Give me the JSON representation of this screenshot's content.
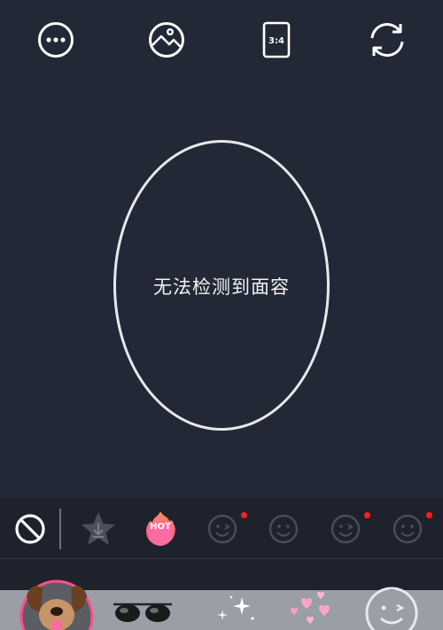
{
  "top_bar": {
    "buttons": [
      {
        "name": "more-options",
        "icon": "ellipsis-circle-icon"
      },
      {
        "name": "gallery",
        "icon": "photo-icon"
      },
      {
        "name": "aspect-ratio",
        "icon": "aspect-ratio-icon",
        "label": "3:4"
      },
      {
        "name": "switch-camera",
        "icon": "rotate-camera-icon"
      }
    ]
  },
  "face_guide": {
    "message": "无法检测到面容"
  },
  "effect_tabs": [
    {
      "name": "none",
      "icon": "no-effect-icon"
    },
    {
      "name": "favorites",
      "icon": "star-download-icon"
    },
    {
      "name": "hot",
      "icon": "hot-flame-icon",
      "label": "HOT",
      "color": "#ff5f9a"
    },
    {
      "name": "category-1",
      "icon": "wink-face-icon",
      "new": true
    },
    {
      "name": "category-2",
      "icon": "smile-face-icon",
      "new": false
    },
    {
      "name": "category-3",
      "icon": "wink-face-icon",
      "new": true
    },
    {
      "name": "category-4",
      "icon": "smile-face-icon",
      "new": true
    }
  ],
  "stickers": [
    {
      "name": "puppy-ears",
      "icon": "dog-face-icon",
      "selected": true,
      "ring_color": "#ff4f8b"
    },
    {
      "name": "sunglasses",
      "icon": "sunglasses-icon"
    },
    {
      "name": "sparkles",
      "icon": "sparkle-icon"
    },
    {
      "name": "floating-hearts",
      "icon": "hearts-icon"
    },
    {
      "name": "wink-placeholder",
      "icon": "wink-face-icon"
    }
  ],
  "colors": {
    "background": "#222836",
    "tray": "#1d222d",
    "new_dot": "#ff1e1e",
    "accent_pink": "#ff4f8b"
  }
}
